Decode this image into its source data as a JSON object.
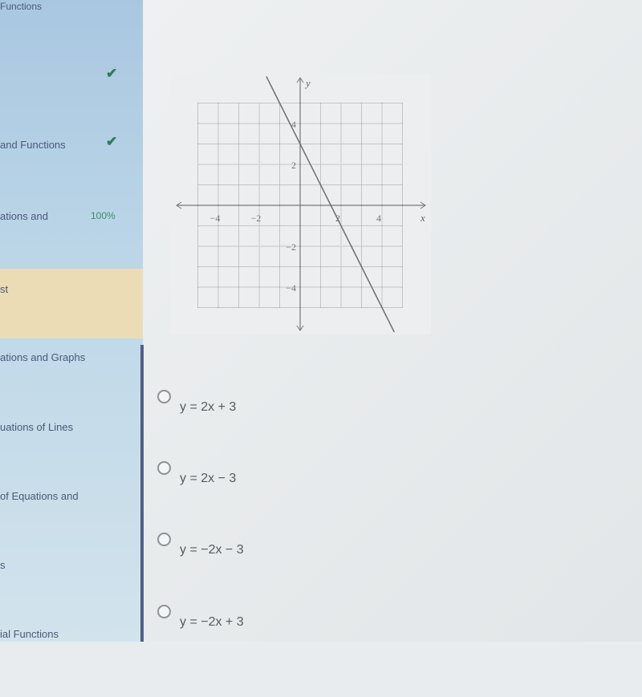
{
  "sidebar": {
    "items": [
      {
        "label": "Functions",
        "status": ""
      },
      {
        "label": "",
        "status": "check"
      },
      {
        "label": "and Functions",
        "status": "check"
      },
      {
        "label": "ations and",
        "status": "100%"
      },
      {
        "label": "st",
        "status": "",
        "active": true
      },
      {
        "label": "ations and Graphs",
        "status": ""
      },
      {
        "label": "uations of Lines",
        "status": ""
      },
      {
        "label": "of Equations and",
        "status": ""
      },
      {
        "label": "s",
        "status": ""
      },
      {
        "label": "ial Functions",
        "status": ""
      }
    ]
  },
  "question": {
    "options": [
      {
        "label": "y = 2x + 3",
        "selected": false
      },
      {
        "label": "y = 2x − 3",
        "selected": false
      },
      {
        "label": "y = −2x − 3",
        "selected": false
      },
      {
        "label": "y = −2x + 3",
        "selected": false
      }
    ]
  },
  "chart_data": {
    "type": "line",
    "xlabel": "x",
    "ylabel": "y",
    "xlim": [
      -5,
      5
    ],
    "ylim": [
      -5,
      5
    ],
    "grid": true,
    "xticks": [
      "-4",
      "-2",
      "2",
      "4"
    ],
    "yticks": [
      "4",
      "2",
      "-2",
      "-4"
    ],
    "series": [
      {
        "x": [
          -1.65,
          4.6
        ],
        "y": [
          6.3,
          -6.2
        ]
      }
    ],
    "line_color": "#6a6f74"
  }
}
